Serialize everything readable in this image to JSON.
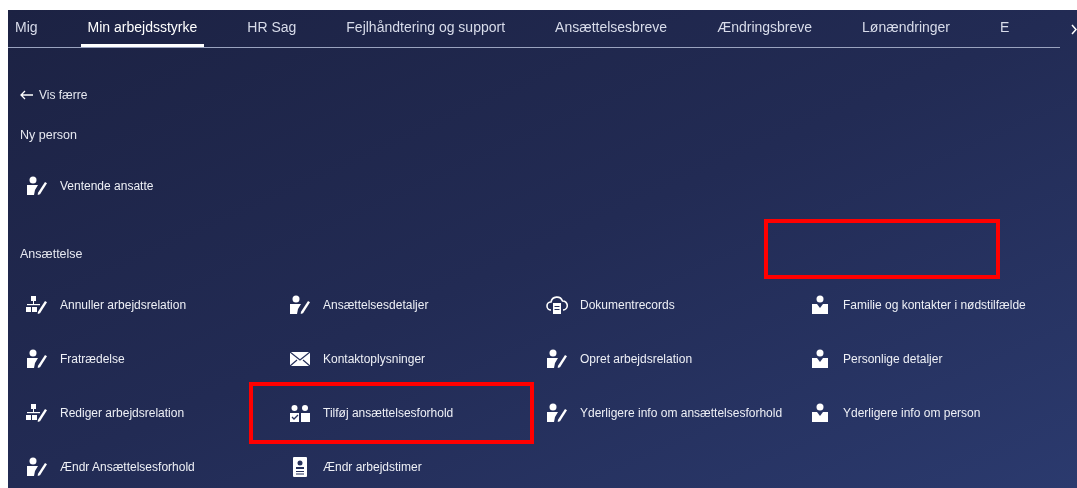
{
  "tabs": [
    {
      "label": "Mig",
      "selected": false
    },
    {
      "label": "Min arbejdsstyrke",
      "selected": true
    },
    {
      "label": "HR Sag",
      "selected": false
    },
    {
      "label": "Fejlhåndtering og support",
      "selected": false
    },
    {
      "label": "Ansættelsesbreve",
      "selected": false
    },
    {
      "label": "Ændringsbreve",
      "selected": false
    },
    {
      "label": "Lønændringer",
      "selected": false
    },
    {
      "label": "E",
      "selected": false
    }
  ],
  "back_link": {
    "label": "Vis færre"
  },
  "sections": [
    {
      "title": "Ny person",
      "items": [
        {
          "label": "Ventende ansatte",
          "kind": "person-edit",
          "highlighted": false
        }
      ]
    },
    {
      "title": "Ansættelse",
      "empty_highlight": true,
      "items": [
        {
          "label": "Annuller arbejdsrelation",
          "kind": "org-edit",
          "highlighted": false
        },
        {
          "label": "Ansættelsesdetaljer",
          "kind": "person-edit",
          "highlighted": false
        },
        {
          "label": "Dokumentrecords",
          "kind": "cloud-doc",
          "highlighted": false
        },
        {
          "label": "Familie og kontakter i nødstilfælde",
          "kind": "person",
          "highlighted": false
        },
        {
          "label": "Fratrædelse",
          "kind": "person-edit",
          "highlighted": false
        },
        {
          "label": "Kontaktoplysninger",
          "kind": "envelope",
          "highlighted": false
        },
        {
          "label": "Opret arbejdsrelation",
          "kind": "person-edit",
          "highlighted": false
        },
        {
          "label": "Personlige detaljer",
          "kind": "person",
          "highlighted": false
        },
        {
          "label": "Rediger arbejdsrelation",
          "kind": "org-edit",
          "highlighted": false
        },
        {
          "label": "Tilføj ansættelsesforhold",
          "kind": "people-check",
          "highlighted": true
        },
        {
          "label": "Yderligere info om ansættelsesforhold",
          "kind": "person-edit",
          "highlighted": false
        },
        {
          "label": "Yderligere info om person",
          "kind": "person",
          "highlighted": false
        },
        {
          "label": "Ændr Ansættelsesforhold",
          "kind": "person-edit",
          "highlighted": false
        },
        {
          "label": "Ændr arbejdstimer",
          "kind": "badge",
          "highlighted": false
        }
      ]
    }
  ]
}
